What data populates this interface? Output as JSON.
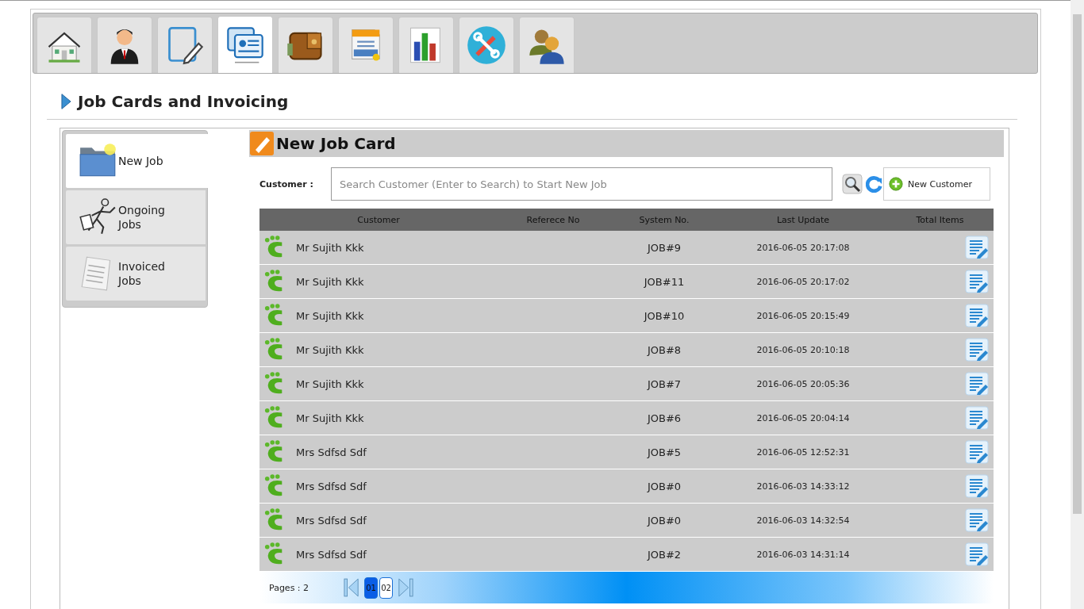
{
  "tabs": [
    {
      "kind": "home",
      "selected": false
    },
    {
      "kind": "person",
      "selected": false
    },
    {
      "kind": "edit",
      "selected": false
    },
    {
      "kind": "cards",
      "selected": true
    },
    {
      "kind": "wallet",
      "selected": false
    },
    {
      "kind": "paycard",
      "selected": false
    },
    {
      "kind": "chart",
      "selected": false
    },
    {
      "kind": "tools",
      "selected": false
    },
    {
      "kind": "users",
      "selected": false
    }
  ],
  "page_title": "Job Cards and Invoicing",
  "sidebar": {
    "items": [
      {
        "kind": "folder",
        "label": "New Job",
        "selected": true
      },
      {
        "kind": "runner",
        "label": "Ongoing Jobs",
        "selected": false
      },
      {
        "kind": "invoice",
        "label": "Invoiced Jobs",
        "selected": false
      }
    ]
  },
  "panel": {
    "title": "New Job Card",
    "customer_label": "Customer :",
    "search": {
      "placeholder": "Search Customer (Enter to Search) to Start New Job"
    },
    "new_customer_button": "New Customer"
  },
  "table": {
    "columns": [
      "Customer",
      "Referece No",
      "System No.",
      "Last Update",
      "Total Items"
    ],
    "rows": [
      {
        "customer": "Mr Sujith Kkk",
        "system_no": "JOB#9",
        "last_update": "2016-06-05 20:17:08"
      },
      {
        "customer": "Mr Sujith Kkk",
        "system_no": "JOB#11",
        "last_update": "2016-06-05 20:17:02"
      },
      {
        "customer": "Mr Sujith Kkk",
        "system_no": "JOB#10",
        "last_update": "2016-06-05 20:15:49"
      },
      {
        "customer": "Mr Sujith Kkk",
        "system_no": "JOB#8",
        "last_update": "2016-06-05 20:10:18"
      },
      {
        "customer": "Mr Sujith Kkk",
        "system_no": "JOB#7",
        "last_update": "2016-06-05 20:05:36"
      },
      {
        "customer": "Mr Sujith Kkk",
        "system_no": "JOB#6",
        "last_update": "2016-06-05 20:04:14"
      },
      {
        "customer": "Mrs Sdfsd Sdf",
        "system_no": "JOB#5",
        "last_update": "2016-06-05 12:52:31"
      },
      {
        "customer": "Mrs Sdfsd Sdf",
        "system_no": "JOB#0",
        "last_update": "2016-06-03 14:33:12"
      },
      {
        "customer": "Mrs Sdfsd Sdf",
        "system_no": "JOB#0",
        "last_update": "2016-06-03 14:32:54"
      },
      {
        "customer": "Mrs Sdfsd Sdf",
        "system_no": "JOB#2",
        "last_update": "2016-06-03 14:31:14"
      }
    ]
  },
  "pagination": {
    "label": "Pages : 2",
    "pages": [
      {
        "label": "01",
        "selected": true
      },
      {
        "label": "02",
        "selected": false
      }
    ]
  }
}
